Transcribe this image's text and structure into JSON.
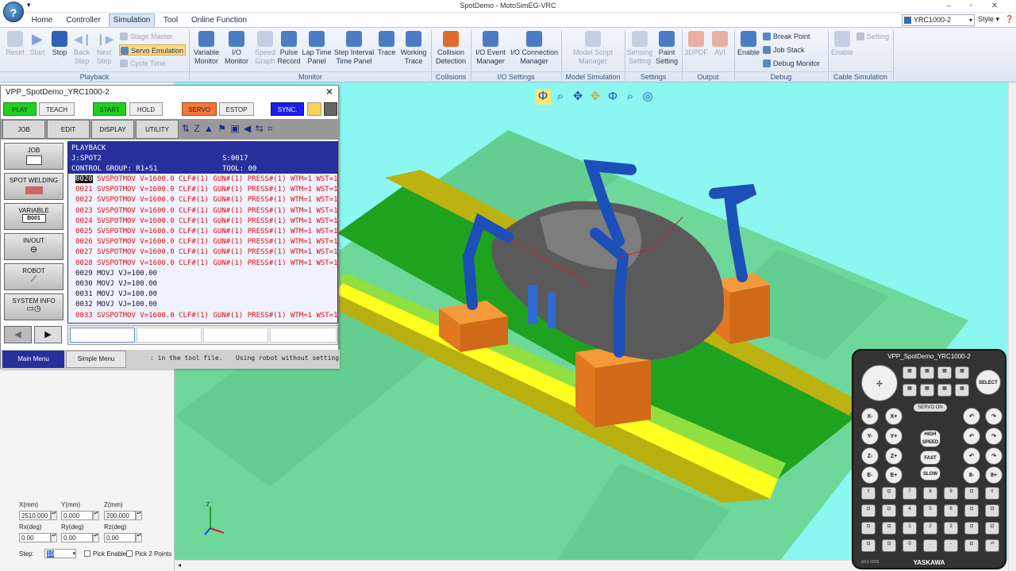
{
  "window": {
    "title": "SpotDemo - MotoSimEG-VRC"
  },
  "quick_access": "▾",
  "tabs": [
    "Home",
    "Controller",
    "Simulation",
    "Tool",
    "Online Function"
  ],
  "active_tab": "Simulation",
  "controller_select": "YRC1000-2",
  "style_menu": "Style",
  "ribbon": {
    "playback": {
      "reset": "Reset",
      "start": "Start",
      "stop": "Stop",
      "back_step": "Back\nStep",
      "next_step": "Next\nStep",
      "stage_master": "Stage Master",
      "servo_emulation": "Servo Emulation",
      "cycle_time": "Cycle Time",
      "group": "Playback"
    },
    "monitor": {
      "items": [
        "Variable\nMonitor",
        "I/O\nMonitor",
        "Speed\nGraph",
        "Pulse\nRecord",
        "Lap Time\nPanel",
        "Step Interval\nTime Panel",
        "Trace",
        "Working\nTrace"
      ],
      "group": "Monitor"
    },
    "collisions": {
      "items": [
        "Collision\nDetection"
      ],
      "group": "Collisions"
    },
    "io_settings": {
      "items": [
        "I/O Event\nManager",
        "I/O Connection\nManager"
      ],
      "group": "I/O Settings"
    },
    "model_sim": {
      "items": [
        "Model Script\nManager"
      ],
      "group": "Model Simulation"
    },
    "settings": {
      "items": [
        "Sensing\nSetting",
        "Paint\nSetting"
      ],
      "group": "Settings"
    },
    "output": {
      "items": [
        "3DPDF",
        "AVI"
      ],
      "group": "Output"
    },
    "debug": {
      "enable": "Enable",
      "break_point": "Break Point",
      "job_stack": "Job Stack",
      "debug_monitor": "Debug Monitor",
      "group": "Debug"
    },
    "cable": {
      "enable": "Enable",
      "setting": "Setting",
      "group": "Cable Simulation"
    }
  },
  "pendant": {
    "title": "VPP_SpotDemo_YRC1000-2",
    "close": "✕",
    "mode_buttons": [
      "PLAY",
      "TEACH",
      "START",
      "HOLD",
      "SERVO ON",
      "ESTOP",
      "SYNC."
    ],
    "menu_buttons": [
      "JOB",
      "EDIT",
      "DISPLAY",
      "UTILITY"
    ],
    "side_buttons": [
      "JOB",
      "SPOT WELDING",
      "VARIABLE",
      "IN/OUT",
      "ROBOT",
      "SYSTEM INFO"
    ],
    "variable_tag": "B001",
    "header": {
      "mode": "PLAYBACK",
      "job": "J:SPOT2",
      "step": "S:0017",
      "group": "CONTROL GROUP: R1+S1",
      "tool": "TOOL: 00"
    },
    "lines": [
      {
        "no": "0020",
        "text": "SVSPOTMOV V=1600.0 CLF#(1) GUN#(1) PRESS#(1) WTM=1 WST=1",
        "type": "spot"
      },
      {
        "no": "0021",
        "text": "SVSPOTMOV V=1600.0 CLF#(1) GUN#(1) PRESS#(1) WTM=1 WST=1",
        "type": "spot"
      },
      {
        "no": "0022",
        "text": "SVSPOTMOV V=1600.0 CLF#(1) GUN#(1) PRESS#(1) WTM=1 WST=1",
        "type": "spot"
      },
      {
        "no": "0023",
        "text": "SVSPOTMOV V=1600.0 CLF#(1) GUN#(1) PRESS#(1) WTM=1 WST=1",
        "type": "spot"
      },
      {
        "no": "0024",
        "text": "SVSPOTMOV V=1600.0 CLF#(1) GUN#(1) PRESS#(1) WTM=1 WST=1",
        "type": "spot"
      },
      {
        "no": "0025",
        "text": "SVSPOTMOV V=1600.0 CLF#(1) GUN#(1) PRESS#(1) WTM=1 WST=1",
        "type": "spot"
      },
      {
        "no": "0026",
        "text": "SVSPOTMOV V=1600.0 CLF#(1) GUN#(1) PRESS#(1) WTM=1 WST=1",
        "type": "spot"
      },
      {
        "no": "0027",
        "text": "SVSPOTMOV V=1600.0 CLF#(1) GUN#(1) PRESS#(1) WTM=1 WST=1",
        "type": "spot"
      },
      {
        "no": "0028",
        "text": "SVSPOTMOV V=1600.0 CLF#(1) GUN#(1) PRESS#(1) WTM=1 WST=1",
        "type": "spot"
      },
      {
        "no": "0029",
        "text": "MOVJ VJ=100.00",
        "type": "mov"
      },
      {
        "no": "0030",
        "text": "MOVJ VJ=100.00",
        "type": "mov"
      },
      {
        "no": "0031",
        "text": "MOVJ VJ=100.00",
        "type": "mov"
      },
      {
        "no": "0032",
        "text": "MOVJ VJ=100.00",
        "type": "mov"
      },
      {
        "no": "0033",
        "text": "SVSPOTMOV V=1600.0 CLF#(1) GUN#(1) PRESS#(1) WTM=1 WST=1",
        "type": "spot"
      }
    ],
    "main_menu": "Main Menu",
    "simple_menu": "Simple Menu",
    "status_msg": ": in the tool file.",
    "status_msg2": "Using robot without setting"
  },
  "coords": {
    "x_label": "X(mm)",
    "x": "2510.000",
    "y_label": "Y(mm)",
    "y": "0.000",
    "z_label": "Z(mm)",
    "z": "200.000",
    "rx_label": "Rx(deg)",
    "rx": "0.00",
    "ry_label": "Ry(deg)",
    "ry": "0.00",
    "rz_label": "Rz(deg)",
    "rz": "0.00",
    "step_label": "Step:",
    "step": "10",
    "pick_enable": "Pick Enable",
    "pick_2points": "Pick 2 Points"
  },
  "teach_pendant": {
    "title": "VPP_SpotDemo_YRC1000-2",
    "brand": "YASKAWA",
    "model": "AK3-000E",
    "select": "SELECT",
    "servo_on": "SERVO ON",
    "high_speed": "HIGH\nSPEED",
    "fast": "FAST",
    "slow": "SLOW"
  },
  "colors": {
    "play": "#1fd11f",
    "start": "#1fd11f",
    "servo_on": "#f4763b",
    "sync": "#1d1df0",
    "job_header": "#25309c",
    "spot_text": "#d11",
    "floor": "#8cf6f0"
  }
}
